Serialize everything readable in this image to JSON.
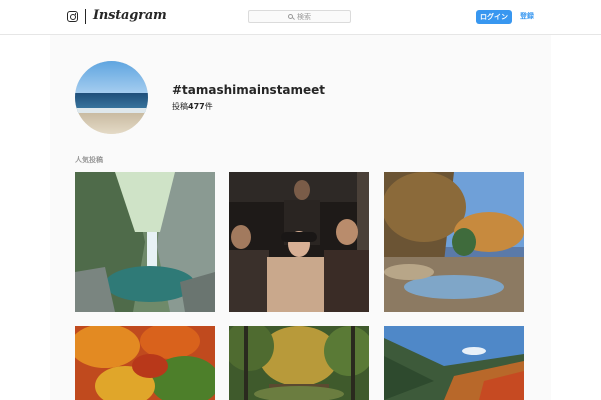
{
  "header": {
    "logo_text": "Instagram",
    "search_placeholder": "検索",
    "login_label": "ログイン",
    "signup_label": "登録"
  },
  "profile": {
    "hashtag": "#tamashimainstameet",
    "post_label": "投稿",
    "post_count": "477",
    "post_unit": "件"
  },
  "section": {
    "top_posts_label": "人気投稿"
  },
  "colors": {
    "accent": "#3897f0",
    "text": "#262626",
    "muted": "#999999",
    "background": "#fafafa"
  },
  "posts": [
    {
      "subject": "waterfall-gorge"
    },
    {
      "subject": "group-night-portrait"
    },
    {
      "subject": "autumn-river-valley"
    },
    {
      "subject": "red-maple-leaves"
    },
    {
      "subject": "forest-footbridge"
    },
    {
      "subject": "autumn-mountain-slope"
    }
  ]
}
